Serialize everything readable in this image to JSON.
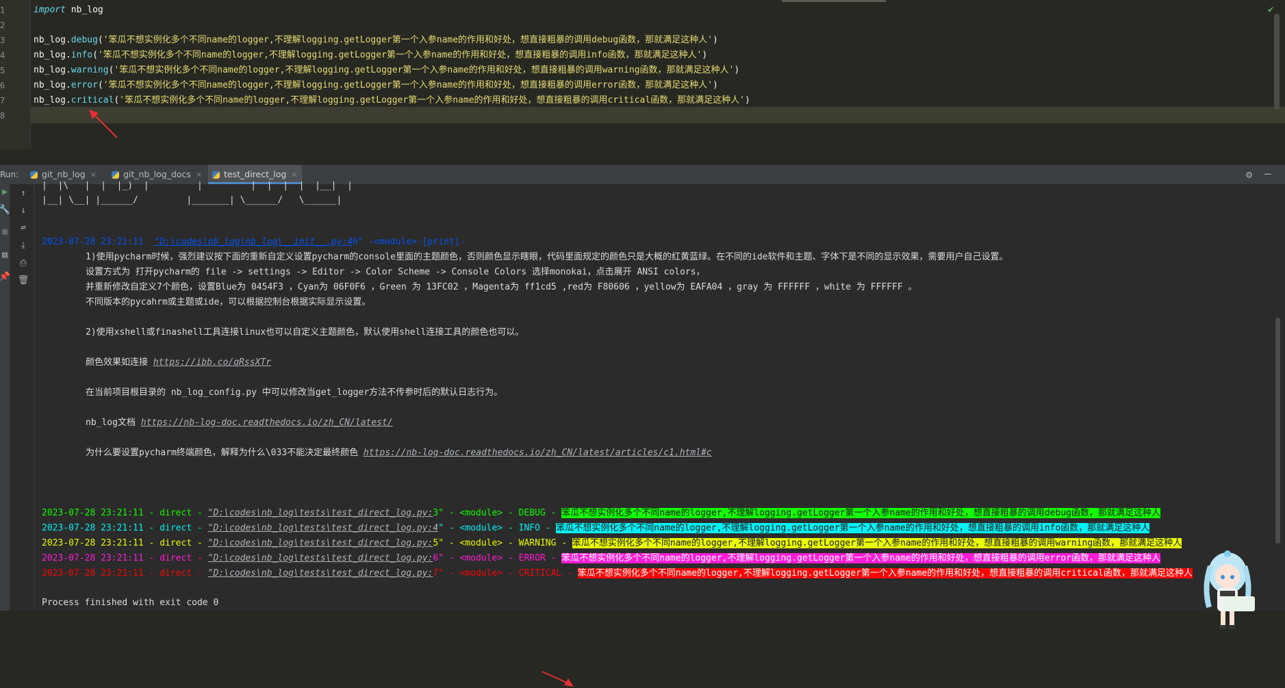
{
  "editor": {
    "line_numbers": [
      "1",
      "2",
      "3",
      "4",
      "5",
      "6",
      "7",
      "8"
    ],
    "lines": [
      {
        "kw": "import",
        "rest": " nb_log"
      },
      {},
      {
        "obj": "nb_log.",
        "fn": "debug",
        "open": "(",
        "str": "'笨瓜不想实例化多个不同name的logger,不理解logging.getLogger第一个入参name的作用和好处，想直接粗暴的调用debug函数，那就满足这种人'",
        "close": ")"
      },
      {
        "obj": "nb_log.",
        "fn": "info",
        "open": "(",
        "str": "'笨瓜不想实例化多个不同name的logger,不理解logging.getLogger第一个入参name的作用和好处，想直接粗暴的调用info函数，那就满足这种人'",
        "close": ")"
      },
      {
        "obj": "nb_log.",
        "fn": "warning",
        "open": "(",
        "str": "'笨瓜不想实例化多个不同name的logger,不理解logging.getLogger第一个入参name的作用和好处，想直接粗暴的调用warning函数，那就满足这种人'",
        "close": ")"
      },
      {
        "obj": "nb_log.",
        "fn": "error",
        "open": "(",
        "str": "'笨瓜不想实例化多个不同name的logger,不理解logging.getLogger第一个入参name的作用和好处，想直接粗暴的调用error函数，那就满足这种人'",
        "close": ")"
      },
      {
        "obj": "nb_log.",
        "fn": "critical",
        "open": "(",
        "str": "'笨瓜不想实例化多个不同name的logger,不理解logging.getLogger第一个入参name的作用和好处，想直接粗暴的调用critical函数，那就满足这种人'",
        "close": ")"
      },
      {}
    ]
  },
  "run": {
    "label": "Run:",
    "tabs": [
      {
        "label": "git_nb_log",
        "active": false
      },
      {
        "label": "git_nb_log_docs",
        "active": false
      },
      {
        "label": "test_direct_log",
        "active": true
      }
    ]
  },
  "console": {
    "ascii": [
      "|  |\\   |  |  |_)  |         |         |  |  |  |  |__|  |",
      "|__| \\__| |______/         |_______| \\______/   \\______|"
    ],
    "print_header": {
      "date": "2023-07-28 23:21:11",
      "path": "\"D:\\codes\\nb_log\\nb_log\\__init__.py:4",
      "path_tail": "6\"",
      "module": "-<module>-[print]-"
    },
    "notes": [
      "1)使用pycharm时候，强烈建议按下面的重新自定义设置pycharm的console里面的主题颜色，否则颜色显示瞎眼，代码里面规定的颜色只是大概的红黄蓝绿。在不同的ide软件和主题、字体下是不同的显示效果，需要用户自己设置。",
      "设置方式为 打开pycharm的 file -> settings -> Editor -> Color Scheme -> Console Colors 选择monokai，点击展开 ANSI colors，",
      "并重新修改自定义7个颜色，设置Blue为 0454F3 ，Cyan为 06F0F6 ，Green 为 13FC02 ，Magenta为 ff1cd5 ,red为 F80606 ，yellow为 EAFA04 ，gray 为 FFFFFF ，white 为 FFFFFF 。",
      "不同版本的pycahrm或主题或ide，可以根据控制台根据实际显示设置。",
      "",
      "2)使用xshell或finashell工具连接linux也可以自定义主题颜色，默认使用shell连接工具的颜色也可以。",
      ""
    ],
    "link_lines": [
      {
        "prefix": "颜色效果如连接 ",
        "url": "https://ibb.co/qRssXTr"
      },
      {
        "prefix": "在当前项目根目录的 nb_log_config.py 中可以修改当get_logger方法不传参时后的默认日志行为。",
        "url": ""
      },
      {
        "prefix": "nb_log文档 ",
        "url": "https://nb-log-doc.readthedocs.io/zh_CN/latest/"
      },
      {
        "prefix": "为什么要设置pycharm终端颜色，解释为什么\\033不能决定最终颜色 ",
        "url": "https://nb-log-doc.readthedocs.io/zh_CN/latest/articles/c1.html#c"
      }
    ],
    "logs": [
      {
        "date": "2023-07-28 23:21:11",
        "name": "direct",
        "path": "\"D:\\codes\\nb_log\\tests\\test_direct_log.py:",
        "lineno": "3\"",
        "module": "<module>",
        "level": "DEBUG",
        "msg": "笨瓜不想实例化多个不同name的logger,不理解logging.getLogger第一个入参name的作用和好处，想直接粗暴的调用debug函数，那就满足这种人",
        "fg": "#13FC02",
        "bg": "#13FC02",
        "msgfg": "#1a1a1a"
      },
      {
        "date": "2023-07-28 23:21:11",
        "name": "direct",
        "path": "\"D:\\codes\\nb_log\\tests\\test_direct_log.py:4",
        "lineno": "\"",
        "module": "<module>",
        "level": "INFO",
        "msg": "笨瓜不想实例化多个不同name的logger,不理解logging.getLogger第一个入参name的作用和好处，想直接粗暴的调用info函数，那就满足这种人",
        "fg": "#06F0F6",
        "bg": "#06F0F6",
        "msgfg": "#1a1a1a"
      },
      {
        "date": "2023-07-28 23:21:11",
        "name": "direct",
        "path": "\"D:\\codes\\nb_log\\tests\\test_direct_log.py:",
        "lineno": "5\"",
        "module": "<module>",
        "level": "WARNING",
        "msg": "笨瓜不想实例化多个不同name的logger,不理解logging.getLogger第一个入参name的作用和好处，想直接粗暴的调用warning函数，那就满足这种人",
        "fg": "#EAFA04",
        "bg": "#EAFA04",
        "msgfg": "#1a1a1a"
      },
      {
        "date": "2023-07-28 23:21:11",
        "name": "direct",
        "path": "\"D:\\codes\\nb_log\\tests\\test_direct_log.py:",
        "lineno": "6\"",
        "module": "<module>",
        "level": "ERROR",
        "msg": "笨瓜不想实例化多个不同name的logger,不理解logging.getLogger第一个入参name的作用和好处，想直接粗暴的调用error函数，那就满足这种人",
        "fg": "#ff1cd5",
        "bg": "#ff1cd5",
        "msgfg": "#ffffff"
      },
      {
        "date": "2023-07-28 23:21:11",
        "name": "direct",
        "path": "\"D:\\codes\\nb_log\\tests\\test_direct_log.py:",
        "lineno": "7\"",
        "module": "<module>",
        "level": "CRITICAL",
        "msg": "笨瓜不想实例化多个不同name的logger,不理解logging.getLogger第一个入参name的作用和好处，想直接粗暴的调用critical函数，那就满足这种人",
        "fg": "#F80606",
        "bg": "#F80606",
        "msgfg": "#ffffff"
      }
    ],
    "exit_text": "Process finished with exit code 0"
  },
  "icons": {
    "run": "run-icon",
    "wrench": "wrench-icon",
    "stop": "stop-icon",
    "layout": "layout-icon",
    "pin": "pin-icon",
    "up": "arrow-up-icon",
    "down": "arrow-down-icon",
    "wrap": "soft-wrap-icon",
    "scroll": "scroll-to-end-icon",
    "print": "print-icon",
    "trash": "trash-icon",
    "gear": "gear-icon",
    "minimize": "minimize-icon",
    "check": "check-icon"
  },
  "colors": {
    "editor_bg": "#272822",
    "console_bg": "#2b2b2b",
    "tab_accent": "#4a88c7",
    "arrow": "#e53030"
  }
}
